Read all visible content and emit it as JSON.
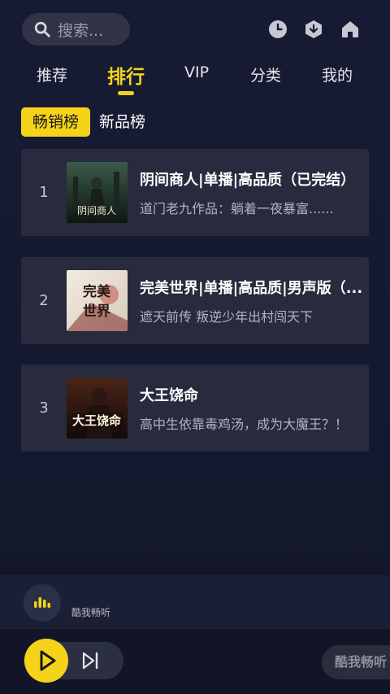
{
  "search": {
    "placeholder": "搜索..."
  },
  "header": {
    "icons": [
      "history-icon",
      "download-icon",
      "home-icon"
    ]
  },
  "tabs": [
    {
      "label": "推荐"
    },
    {
      "label": "排行",
      "active": true
    },
    {
      "label": "VIP"
    },
    {
      "label": "分类"
    },
    {
      "label": "我的"
    }
  ],
  "subtabs": [
    {
      "label": "畅销榜",
      "active": true
    },
    {
      "label": "新品榜"
    }
  ],
  "ranking": [
    {
      "rank": "1",
      "title": "阴间商人|单播|高品质（已完结）",
      "desc": "道门老九作品：躺着一夜暴富......",
      "cover_text": "阴间商人"
    },
    {
      "rank": "2",
      "title": "完美世界|单播|高品质|男声版（...",
      "desc": "遮天前传 叛逆少年出村闯天下",
      "cover_text": "完美世界"
    },
    {
      "rank": "3",
      "title": "大王饶命",
      "desc": "高中生依靠毒鸡汤，成为大魔王？！",
      "cover_text": "大王饶命"
    }
  ],
  "player": {
    "app_name": "酷我畅听",
    "brand_label": "酷我畅听"
  },
  "colors": {
    "accent": "#f4d31a",
    "background": "#161a33",
    "card": "#272b3d"
  }
}
